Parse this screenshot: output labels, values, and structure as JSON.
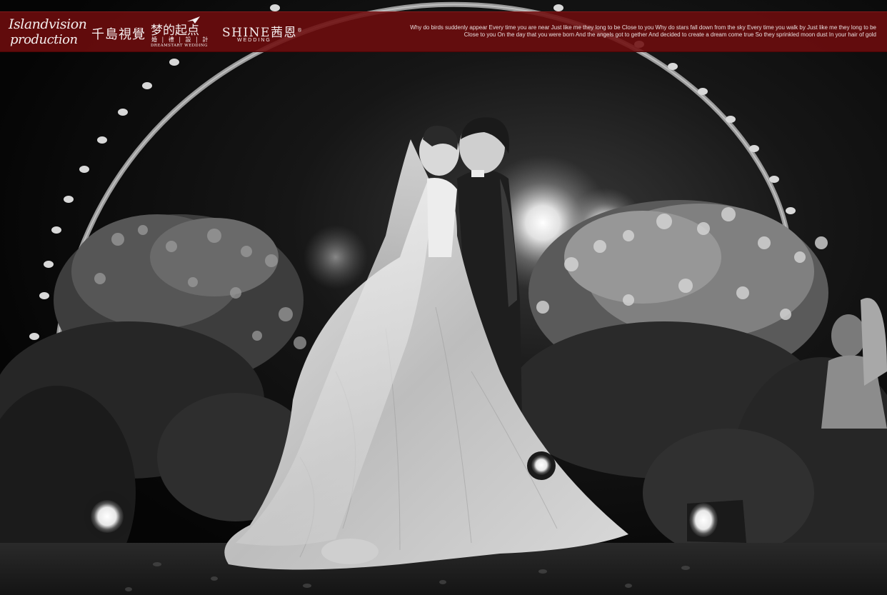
{
  "banner": {
    "logo_islandvision": {
      "line1": "Islandvision",
      "line2": "production"
    },
    "logo_chidao": "千島視覺",
    "logo_dreamstart": {
      "cn": "梦的起点",
      "sub": "婚 | 禮 | 設 | 計",
      "en": "DREAMSTART WEDDING"
    },
    "logo_shine": {
      "main": "SHINE茜恩",
      "mark": "®",
      "sub": "WEDDING"
    },
    "lyrics": {
      "line1": "Why do birds suddenly appear Every time you are near Just like me they long to be Close to you Why do stars fall down from the sky Every time you walk by Just like me they long to be",
      "line2": "Close to you On the day that you were born And the angels got to gether And decided to create a dream come true So they sprinkled moon dust In your hair of gold"
    }
  },
  "colors": {
    "banner": "#6e0c0e",
    "text": "#f4eeee"
  }
}
